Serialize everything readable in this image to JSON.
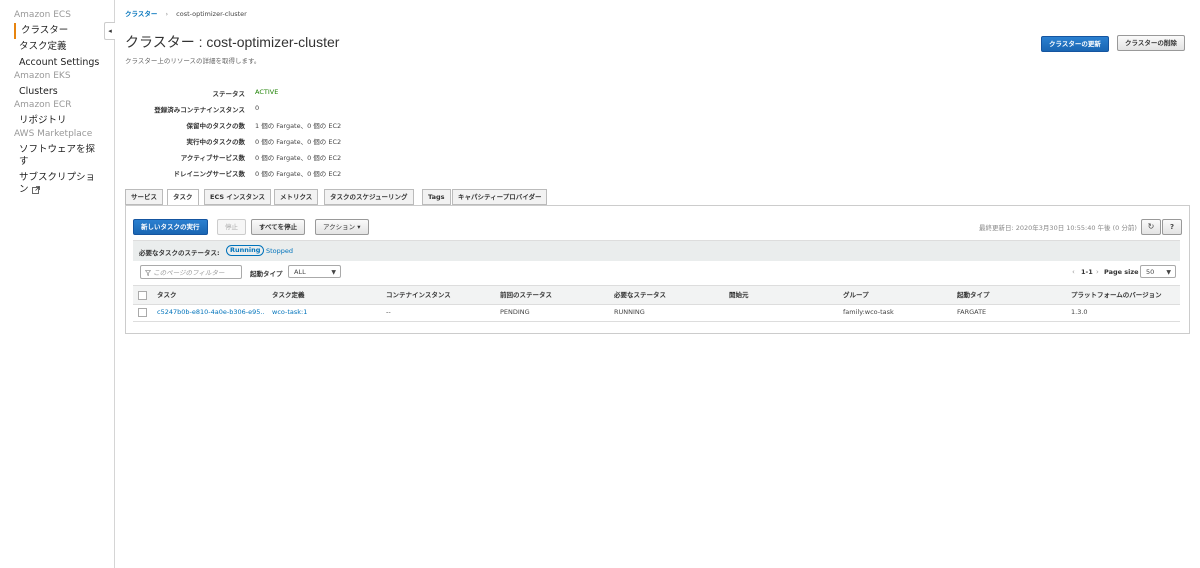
{
  "sidebar": {
    "sections": [
      {
        "title": "Amazon ECS",
        "items": [
          {
            "label": "クラスター",
            "active": true
          },
          {
            "label": "タスク定義"
          },
          {
            "label": "Account Settings"
          }
        ]
      },
      {
        "title": "Amazon EKS",
        "items": [
          {
            "label": "Clusters"
          }
        ]
      },
      {
        "title": "Amazon ECR",
        "items": [
          {
            "label": "リポジトリ"
          }
        ]
      },
      {
        "title": "AWS Marketplace",
        "items": [
          {
            "label": "ソフトウェアを探す"
          },
          {
            "label": "サブスクリプション"
          }
        ]
      }
    ],
    "collapse_glyph": "◂"
  },
  "breadcrumb": {
    "root": "クラスター",
    "separator": "›",
    "current": "cost-optimizer-cluster"
  },
  "header": {
    "title": "クラスター : cost-optimizer-cluster",
    "subtitle": "クラスター上のリソースの詳細を取得します。",
    "update_button": "クラスターの更新",
    "delete_button": "クラスターの削除"
  },
  "details": [
    {
      "label": "ステータス",
      "value": "ACTIVE",
      "accent": "#1d8102"
    },
    {
      "label": "登録済みコンテナインスタンス",
      "value": "0"
    },
    {
      "label": "保留中のタスクの数",
      "value": "1 個の Fargate、0 個の EC2"
    },
    {
      "label": "実行中のタスクの数",
      "value": "0 個の Fargate、0 個の EC2"
    },
    {
      "label": "アクティブサービス数",
      "value": "0 個の Fargate、0 個の EC2"
    },
    {
      "label": "ドレイニングサービス数",
      "value": "0 個の Fargate、0 個の EC2"
    }
  ],
  "tabs": [
    "サービス",
    "タスク",
    "ECS インスタンス",
    "メトリクス",
    "タスクのスケジューリング",
    "Tags",
    "キャパシティープロバイダー"
  ],
  "active_tab": "タスク",
  "toolbar": {
    "run_task": "新しいタスクの実行",
    "stop": "停止",
    "stop_all": "すべてを停止",
    "actions": "アクション",
    "actions_caret": "▾",
    "last_updated": "最終更新日: 2020年3月30日 10:55:40 午後 (0 分前)",
    "refresh_glyph": "↻",
    "help_glyph": "?"
  },
  "filter": {
    "desired_status_label": "必要なタスクのステータス:",
    "running": "Running",
    "stopped": "Stopped",
    "placeholder": "このページのフィルター",
    "launch_type_label": "起動タイプ",
    "launch_type_value": "ALL",
    "pagination": "1-1",
    "page_size_label": "Page size",
    "page_size_value": "50",
    "prev_glyph": "‹",
    "next_glyph": "›",
    "caret": "▼"
  },
  "table": {
    "columns": [
      "タスク",
      "タスク定義",
      "コンテナインスタンス",
      "前回のステータス",
      "必要なステータス",
      "開始元",
      "グループ",
      "起動タイプ",
      "プラットフォームのバージョン"
    ],
    "rows": [
      [
        "c5247b0b-e810-4a0e-b306-e95...",
        "wco-task:1",
        "--",
        "PENDING",
        "RUNNING",
        "",
        "family:wco-task",
        "FARGATE",
        "1.3.0"
      ]
    ]
  },
  "colors": {
    "link": "#0073bb",
    "primary": "#1a66b3",
    "active_nav": "#e7840f",
    "active_status": "#1d8102"
  }
}
